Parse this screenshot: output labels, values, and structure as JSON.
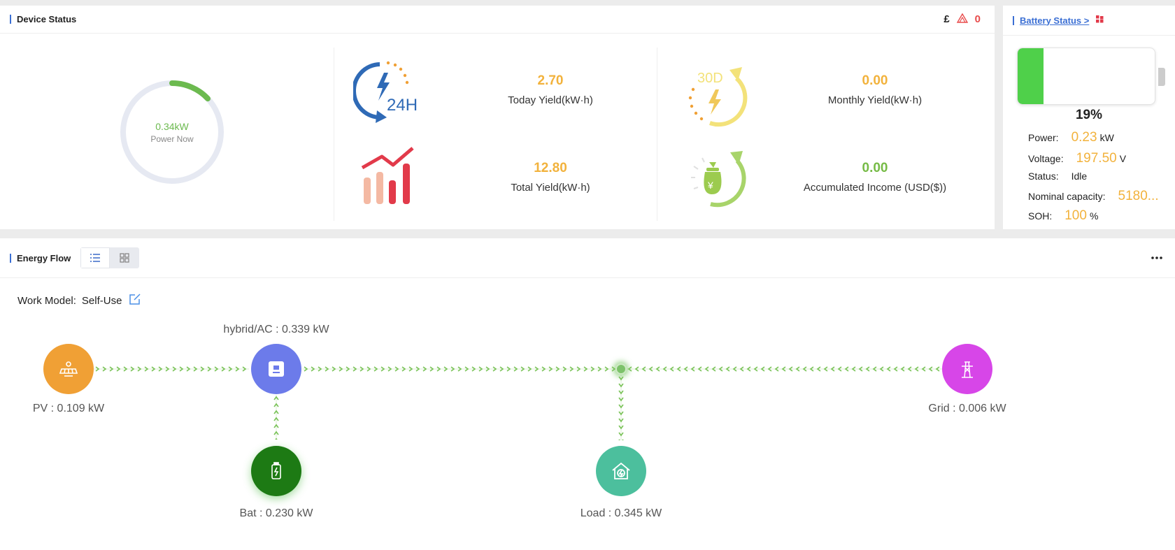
{
  "device_status": {
    "title": "Device Status",
    "currency_symbol": "£",
    "alarm_count": "0",
    "power_now": {
      "value": "0.34kW",
      "label": "Power Now",
      "fraction": 0.13
    },
    "today_yield": {
      "value": "2.70",
      "label": "Today Yield(kW·h)"
    },
    "monthly_yield": {
      "value": "0.00",
      "label": "Monthly Yield(kW·h)"
    },
    "total_yield": {
      "value": "12.80",
      "label": "Total Yield(kW·h)"
    },
    "accumulated_income": {
      "value": "0.00",
      "label": "Accumulated Income (USD($))"
    },
    "icon_24h_text": "24H",
    "icon_30d_text": "30D",
    "icon_yen": "¥"
  },
  "battery_status": {
    "link": "Battery Status >",
    "percent": "19%",
    "soc_fraction": 0.19,
    "rows": [
      {
        "label": "Power:",
        "value": "0.23",
        "unit": "kW"
      },
      {
        "label": "Voltage:",
        "value": "197.50",
        "unit": "V"
      },
      {
        "label": "Status:",
        "value": "Idle",
        "unit": ""
      },
      {
        "label": "Nominal capacity:",
        "value": "5180...",
        "unit": ""
      },
      {
        "label": "SOH:",
        "value": "100",
        "unit": "%"
      }
    ]
  },
  "energy_flow": {
    "title": "Energy Flow",
    "work_model_label": "Work Model:",
    "work_model_value": "Self-Use",
    "nodes": {
      "pv": "PV : 0.109 kW",
      "inverter": "hybrid/AC : 0.339 kW",
      "battery": "Bat : 0.230 kW",
      "load": "Load : 0.345 kW",
      "grid": "Grid : 0.006 kW"
    }
  },
  "colors": {
    "accent": "#3b6fd4",
    "orange": "#f2b23c",
    "green": "#76bb46",
    "pv": "#f0a035",
    "inverter": "#6c7bea",
    "battery": "#1d7a14",
    "load": "#4cbf9d",
    "grid": "#d746e8"
  }
}
